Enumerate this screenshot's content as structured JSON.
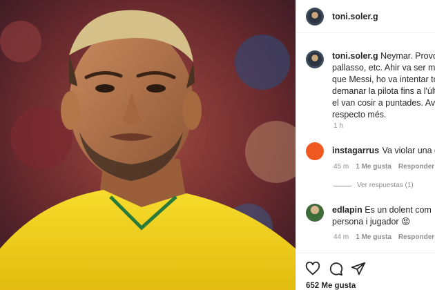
{
  "post": {
    "username": "toni.soler.g",
    "caption_user": "toni.soler.g",
    "caption_lines": [
      "Neymar. Provoca",
      "pallasso, etc. Ahir va ser mol",
      "que Messi, ho va intentar tot",
      "demanar la pilota fins a l'últi",
      "el van cosir a puntades. Avui",
      "respecto més."
    ],
    "caption_time": "1 h",
    "likes": "652 Me gusta"
  },
  "comments": [
    {
      "user": "instagarrus",
      "text": "Va violar una do",
      "time": "45 m",
      "likes": "1 Me gusta",
      "reply": "Responder",
      "replies_link": "Ver respuestas (1)"
    },
    {
      "user": "edlapin",
      "text": "Es un dolent com",
      "text_line2": "persona i jugador",
      "emoji": "😡",
      "time": "44 m",
      "likes": "1 Me gusta",
      "reply": "Responder"
    }
  ],
  "colors": {
    "jersey": "#f5d31b",
    "instagarrus_avatar": "#f05a22",
    "link_blue": "#00376b"
  },
  "icons": [
    "heart-icon",
    "comment-icon",
    "share-icon"
  ]
}
